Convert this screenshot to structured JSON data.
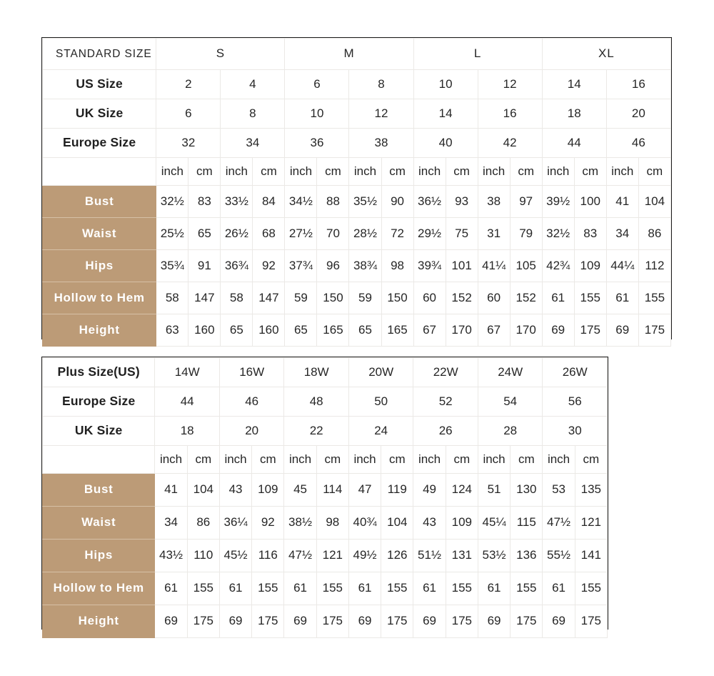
{
  "colors": {
    "accent": "#bc9b77",
    "grid": "#ebe9e6",
    "outline": "#1d1d1d",
    "text": "#1f1f1f",
    "header_text": "#ffffff"
  },
  "standard_chart": {
    "corner_label": "STANDARD SIZE",
    "size_groups": [
      {
        "label": "S",
        "span": 4
      },
      {
        "label": "M",
        "span": 4
      },
      {
        "label": "L",
        "span": 4
      },
      {
        "label": "XL",
        "span": 4
      }
    ],
    "spec_rows": [
      {
        "label": "US Size",
        "values": [
          "2",
          "4",
          "6",
          "8",
          "10",
          "12",
          "14",
          "16"
        ]
      },
      {
        "label": "UK Size",
        "values": [
          "6",
          "8",
          "10",
          "12",
          "14",
          "16",
          "18",
          "20"
        ]
      },
      {
        "label": "Europe Size",
        "values": [
          "32",
          "34",
          "36",
          "38",
          "40",
          "42",
          "44",
          "46"
        ]
      }
    ],
    "unit_row": {
      "label": "",
      "units": [
        "inch",
        "cm",
        "inch",
        "cm",
        "inch",
        "cm",
        "inch",
        "cm",
        "inch",
        "cm",
        "inch",
        "cm",
        "inch",
        "cm",
        "inch",
        "cm"
      ]
    },
    "measure_rows": [
      {
        "label": "Bust",
        "values": [
          "32½",
          "83",
          "33½",
          "84",
          "34½",
          "88",
          "35½",
          "90",
          "36½",
          "93",
          "38",
          "97",
          "39½",
          "100",
          "41",
          "104"
        ]
      },
      {
        "label": "Waist",
        "values": [
          "25½",
          "65",
          "26½",
          "68",
          "27½",
          "70",
          "28½",
          "72",
          "29½",
          "75",
          "31",
          "79",
          "32½",
          "83",
          "34",
          "86"
        ]
      },
      {
        "label": "Hips",
        "values": [
          "35¾",
          "91",
          "36¾",
          "92",
          "37¾",
          "96",
          "38¾",
          "98",
          "39¾",
          "101",
          "41¼",
          "105",
          "42¾",
          "109",
          "44¼",
          "112"
        ]
      },
      {
        "label": "Hollow to Hem",
        "values": [
          "58",
          "147",
          "58",
          "147",
          "59",
          "150",
          "59",
          "150",
          "60",
          "152",
          "60",
          "152",
          "61",
          "155",
          "61",
          "155"
        ]
      },
      {
        "label": "Height",
        "values": [
          "63",
          "160",
          "65",
          "160",
          "65",
          "165",
          "65",
          "165",
          "67",
          "170",
          "67",
          "170",
          "69",
          "175",
          "69",
          "175"
        ]
      }
    ]
  },
  "plus_chart": {
    "spec_rows": [
      {
        "label": "Plus Size(US)",
        "values": [
          "14W",
          "16W",
          "18W",
          "20W",
          "22W",
          "24W",
          "26W"
        ]
      },
      {
        "label": "Europe Size",
        "values": [
          "44",
          "46",
          "48",
          "50",
          "52",
          "54",
          "56"
        ]
      },
      {
        "label": "UK Size",
        "values": [
          "18",
          "20",
          "22",
          "24",
          "26",
          "28",
          "30"
        ]
      }
    ],
    "unit_row": {
      "label": "",
      "units": [
        "inch",
        "cm",
        "inch",
        "cm",
        "inch",
        "cm",
        "inch",
        "cm",
        "inch",
        "cm",
        "inch",
        "cm",
        "inch",
        "cm"
      ]
    },
    "measure_rows": [
      {
        "label": "Bust",
        "values": [
          "41",
          "104",
          "43",
          "109",
          "45",
          "114",
          "47",
          "119",
          "49",
          "124",
          "51",
          "130",
          "53",
          "135"
        ]
      },
      {
        "label": "Waist",
        "values": [
          "34",
          "86",
          "36¼",
          "92",
          "38½",
          "98",
          "40¾",
          "104",
          "43",
          "109",
          "45¼",
          "115",
          "47½",
          "121"
        ]
      },
      {
        "label": "Hips",
        "values": [
          "43½",
          "110",
          "45½",
          "116",
          "47½",
          "121",
          "49½",
          "126",
          "51½",
          "131",
          "53½",
          "136",
          "55½",
          "141"
        ]
      },
      {
        "label": "Hollow to Hem",
        "values": [
          "61",
          "155",
          "61",
          "155",
          "61",
          "155",
          "61",
          "155",
          "61",
          "155",
          "61",
          "155",
          "61",
          "155"
        ]
      },
      {
        "label": "Height",
        "values": [
          "69",
          "175",
          "69",
          "175",
          "69",
          "175",
          "69",
          "175",
          "69",
          "175",
          "69",
          "175",
          "69",
          "175"
        ]
      }
    ]
  }
}
